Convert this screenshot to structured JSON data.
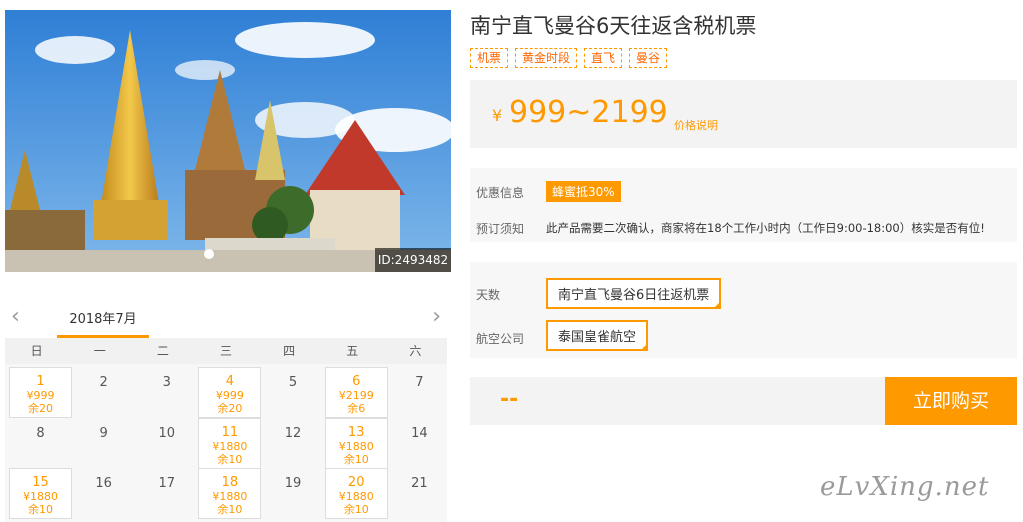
{
  "product": {
    "title": "南宁直飞曼谷6天往返含税机票",
    "tags": [
      "机票",
      "黄金时段",
      "直飞",
      "曼谷"
    ],
    "price": {
      "currency": "¥",
      "range": "999~2199",
      "note": "价格说明"
    }
  },
  "photo": {
    "id_label": "ID:2493482",
    "alt": "temple-photo"
  },
  "info": {
    "promo_label": "优惠信息",
    "promo_badge": "蜂蜜抵30%",
    "notice_label": "预订须知",
    "notice_text": "此产品需要二次确认，商家将在18个工作小时内（工作日9:00-18:00）核实是否有位!"
  },
  "options": {
    "days_label": "天数",
    "days_value": "南宁直飞曼谷6日往返机票",
    "airline_label": "航空公司",
    "airline_value": "泰国皇雀航空"
  },
  "purchase": {
    "quantity": "--",
    "buy_label": "立即购买"
  },
  "calendar": {
    "month_label": "2018年7月",
    "prev_arrow": "‹",
    "next_arrow": "›",
    "weekdays": [
      "日",
      "一",
      "二",
      "三",
      "四",
      "五",
      "六"
    ],
    "days": [
      {
        "d": "1",
        "price": "¥999",
        "remain": "余20"
      },
      {
        "d": "2"
      },
      {
        "d": "3"
      },
      {
        "d": "4",
        "price": "¥999",
        "remain": "余20"
      },
      {
        "d": "5"
      },
      {
        "d": "6",
        "price": "¥2199",
        "remain": "余6"
      },
      {
        "d": "7"
      },
      {
        "d": "8"
      },
      {
        "d": "9"
      },
      {
        "d": "10"
      },
      {
        "d": "11",
        "price": "¥1880",
        "remain": "余10"
      },
      {
        "d": "12"
      },
      {
        "d": "13",
        "price": "¥1880",
        "remain": "余10"
      },
      {
        "d": "14"
      },
      {
        "d": "15",
        "price": "¥1880",
        "remain": "余10"
      },
      {
        "d": "16"
      },
      {
        "d": "17"
      },
      {
        "d": "18",
        "price": "¥1880",
        "remain": "余10"
      },
      {
        "d": "19"
      },
      {
        "d": "20",
        "price": "¥1880",
        "remain": "余10"
      },
      {
        "d": "21"
      }
    ]
  },
  "watermark": "eLvXing.net",
  "colors": {
    "accent": "#ff9900",
    "panel": "#f3f3f3"
  }
}
